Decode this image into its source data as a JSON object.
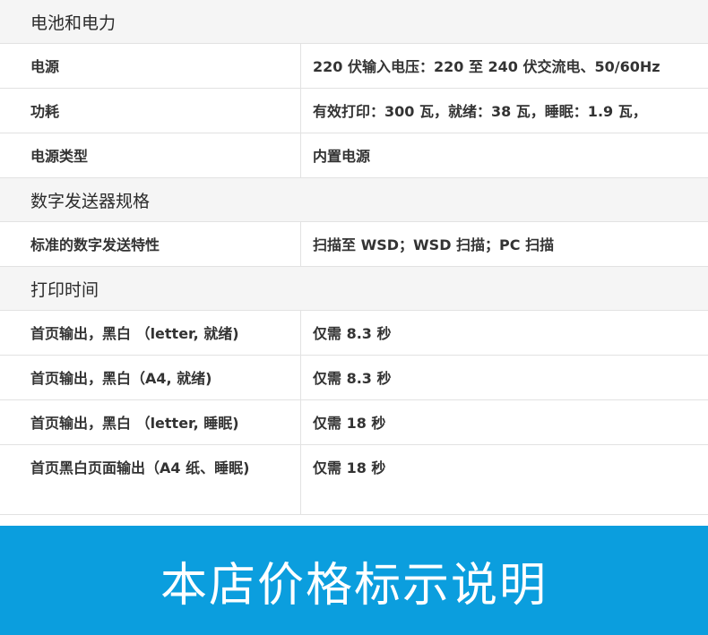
{
  "sections": [
    {
      "title": "电池和电力",
      "rows": [
        {
          "label": "电源",
          "value": "220 伏输入电压：220 至 240 伏交流电、50/60Hz"
        },
        {
          "label": "功耗",
          "value": "有效打印：300 瓦，就绪：38 瓦，睡眠：1.9 瓦，"
        },
        {
          "label": "电源类型",
          "value": "内置电源"
        }
      ]
    },
    {
      "title": "数字发送器规格",
      "rows": [
        {
          "label": "标准的数字发送特性",
          "value": "扫描至 WSD；WSD 扫描；PC 扫描"
        }
      ]
    },
    {
      "title": "打印时间",
      "rows": [
        {
          "label": "首页输出，黑白 （letter, 就绪)",
          "value": "仅需 8.3 秒"
        },
        {
          "label": "首页输出，黑白（A4, 就绪)",
          "value": "仅需 8.3 秒"
        },
        {
          "label": "首页输出，黑白 （letter, 睡眠)",
          "value": "仅需 18 秒"
        },
        {
          "label": "首页黑白页面输出（A4 纸、睡眠)",
          "value": "仅需 18 秒"
        }
      ]
    }
  ],
  "banner": {
    "text": "本店价格标示说明",
    "color": "#0b9ede"
  }
}
